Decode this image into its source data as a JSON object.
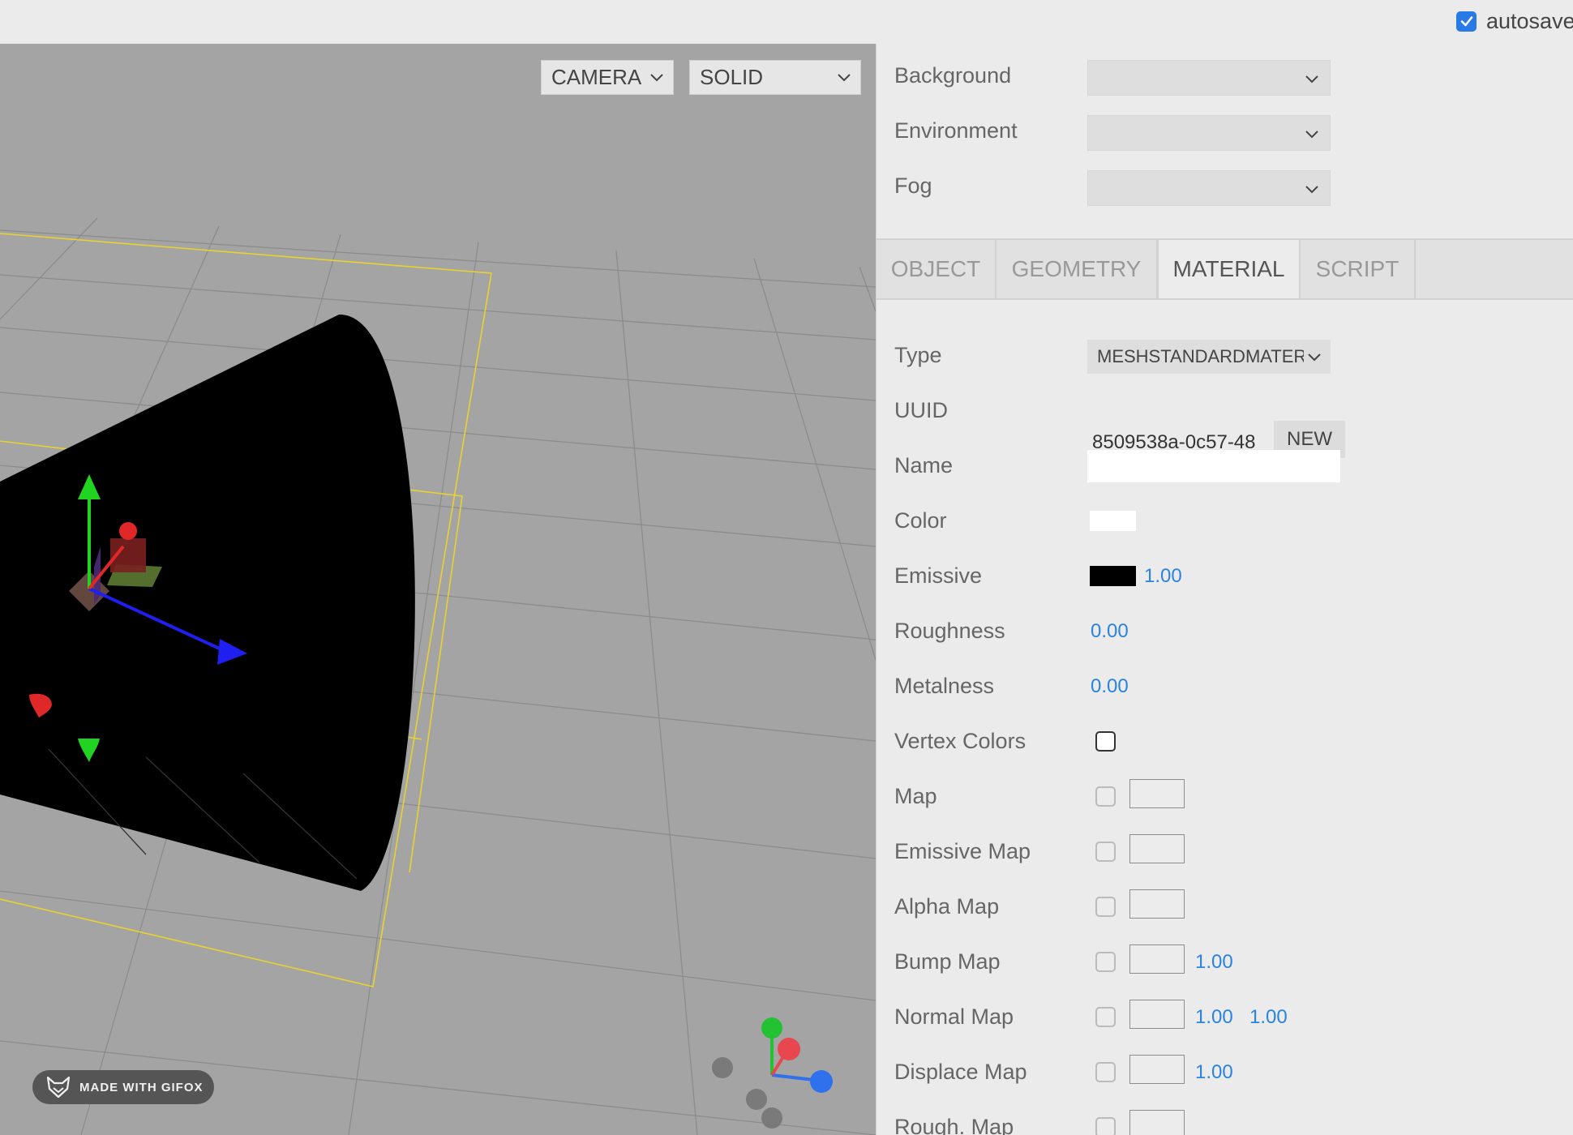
{
  "toolbar": {
    "autosave_label": "autosave",
    "autosave_checked": true
  },
  "viewport": {
    "camera_select": "CAMERA",
    "shading_select": "SOLID",
    "watermark": "MADE WITH GIFOX"
  },
  "scene_panel": {
    "rows": [
      {
        "label": "Background",
        "value": ""
      },
      {
        "label": "Environment",
        "value": ""
      },
      {
        "label": "Fog",
        "value": ""
      }
    ]
  },
  "tabs": [
    {
      "label": "OBJECT",
      "active": false
    },
    {
      "label": "GEOMETRY",
      "active": false
    },
    {
      "label": "MATERIAL",
      "active": true
    },
    {
      "label": "SCRIPT",
      "active": false
    }
  ],
  "material": {
    "type_label": "Type",
    "type_value": "MESHSTANDARDMATERIAL",
    "uuid_label": "UUID",
    "uuid_value": "8509538a-0c57-48",
    "new_button": "NEW",
    "name_label": "Name",
    "name_value": "",
    "color_label": "Color",
    "color_value": "#ffffff",
    "emissive_label": "Emissive",
    "emissive_color": "#000000",
    "emissive_intensity": "1.00",
    "roughness_label": "Roughness",
    "roughness_value": "0.00",
    "metalness_label": "Metalness",
    "metalness_value": "0.00",
    "vertex_colors_label": "Vertex Colors",
    "vertex_colors_checked": false,
    "maps": [
      {
        "label": "Map",
        "values": []
      },
      {
        "label": "Emissive Map",
        "values": []
      },
      {
        "label": "Alpha Map",
        "values": []
      },
      {
        "label": "Bump Map",
        "values": [
          "1.00"
        ]
      },
      {
        "label": "Normal Map",
        "values": [
          "1.00",
          "1.00"
        ]
      },
      {
        "label": "Displace Map",
        "values": [
          "1.00"
        ]
      },
      {
        "label": "Rough. Map",
        "values": []
      }
    ]
  },
  "colors": {
    "accent": "#2979e6",
    "number_text": "#2a83e0",
    "viewport_bg": "#a4a4a4",
    "panel_bg": "#ebebeb"
  }
}
